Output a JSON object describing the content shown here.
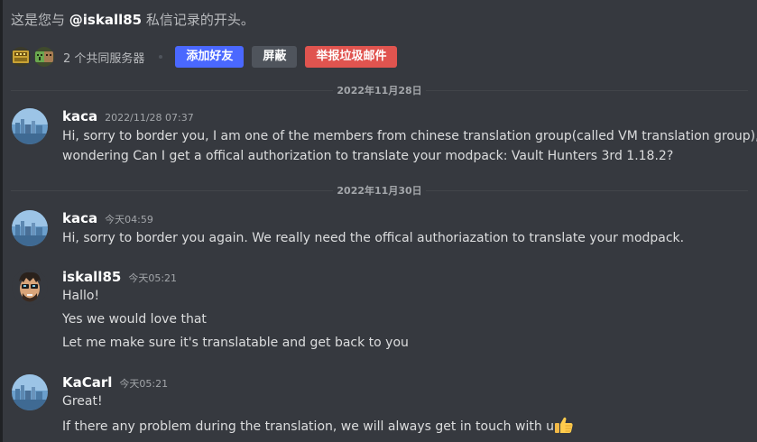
{
  "header": {
    "intro_prefix": "这是您与 ",
    "intro_user": "@iskall85",
    "intro_suffix": " 私信记录的开头。",
    "mutual_servers": "2 个共同服务器",
    "add_friend_label": "添加好友",
    "block_label": "屏蔽",
    "report_spam_label": "举报垃圾邮件",
    "server_icons": [
      "vault-hunters-server-icon",
      "creeper-server-icon"
    ]
  },
  "dividers": [
    {
      "label": "2022年11月28日"
    },
    {
      "label": "2022年11月30日"
    }
  ],
  "messages": [
    {
      "username": "kaca",
      "timestamp": "2022/11/28 07:37",
      "avatar": "city-avatar",
      "lines": [
        "Hi, sorry to border you, I am one of the members from chinese translation group(called VM translation group), I am",
        "wondering Can I get a  offical authorization to translate your modpack: Vault Hunters 3rd 1.18.2?"
      ]
    },
    {
      "username": "kaca",
      "timestamp": "今天04:59",
      "avatar": "city-avatar",
      "lines": [
        "Hi, sorry to border you again. We really need the offical authoriazation to translate your modpack."
      ]
    },
    {
      "username": "iskall85",
      "timestamp": "今天05:21",
      "avatar": "cartoon-face-avatar",
      "lines": [
        "Hallo!",
        "Yes we would love that",
        "Let me make sure it's translatable and get back to you"
      ]
    },
    {
      "username": "KaCarl",
      "timestamp": "今天05:21",
      "avatar": "city-avatar",
      "lines": [
        "Great!",
        "If there any problem during the translation, we will always get in touch with u"
      ],
      "emoji": "thumbs-up-emoji"
    }
  ],
  "colors": {
    "background": "#36393f",
    "add_friend": "#4a68ff",
    "block": "#4f545c",
    "report": "#e0544f",
    "username": "#ffffff",
    "text": "#dcddde",
    "muted": "#a3a6aa"
  }
}
